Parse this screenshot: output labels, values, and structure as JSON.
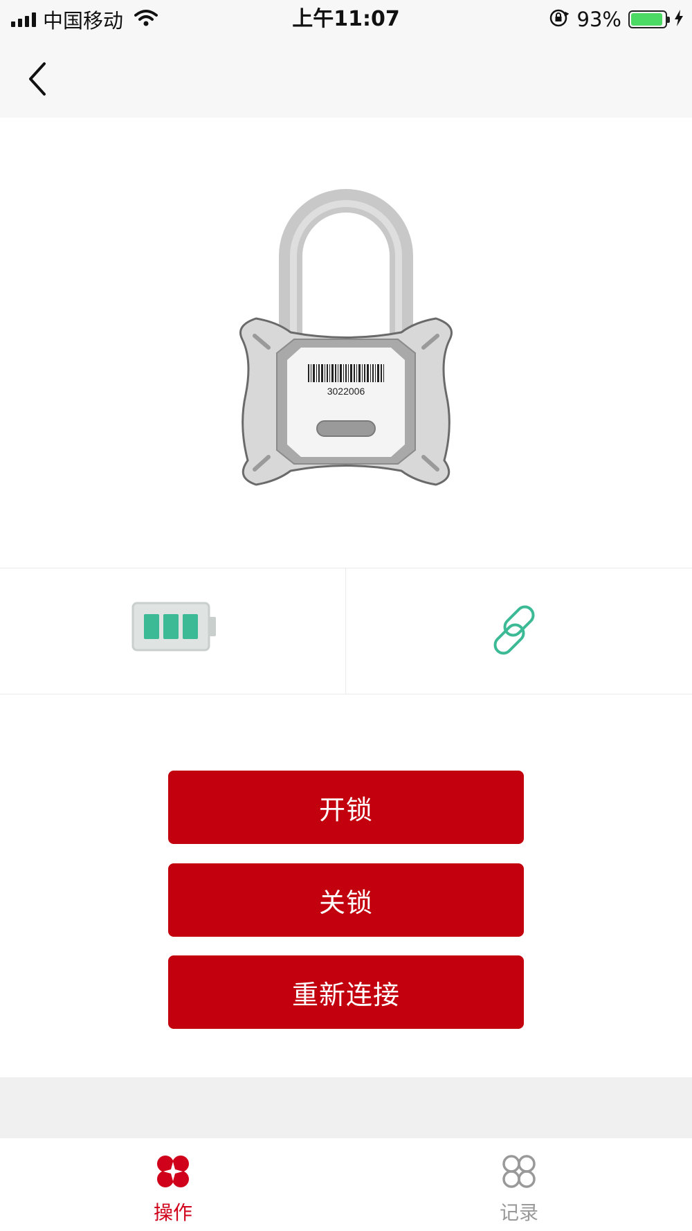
{
  "status_bar": {
    "carrier": "中国移动",
    "time": "上午11:07",
    "battery_percent": "93%",
    "battery_level": 0.93
  },
  "nav": {
    "back_icon": "chevron-left-icon"
  },
  "lock": {
    "serial_number": "3022006"
  },
  "status_row": {
    "battery_icon": "battery-icon",
    "battery_level_bars": 3,
    "connection_icon": "link-icon",
    "accent_color": "#3cb995"
  },
  "actions": {
    "unlock_label": "开锁",
    "lock_label": "关锁",
    "reconnect_label": "重新连接",
    "button_color": "#c3000d"
  },
  "tabs": [
    {
      "label": "操作",
      "icon": "operation-icon",
      "active": true,
      "color": "#d0021b"
    },
    {
      "label": "记录",
      "icon": "records-icon",
      "active": false,
      "color": "#999999"
    }
  ]
}
